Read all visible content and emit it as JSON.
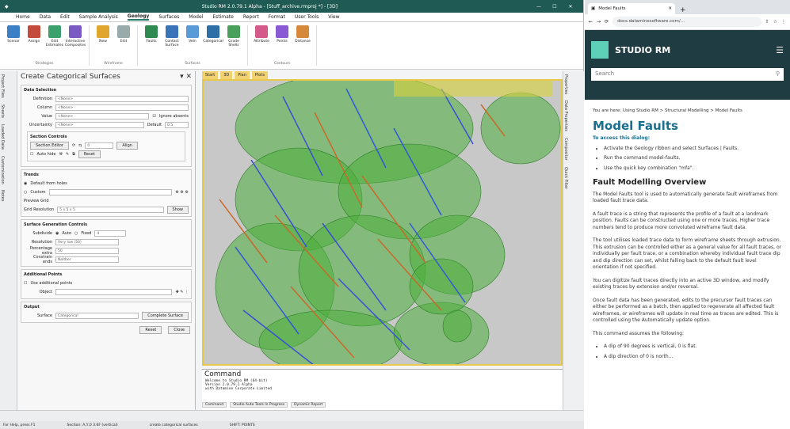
{
  "app": {
    "title": "Studio RM 2.0.79.1 Alpha - [Stuff_archive.rmproj *] - [3D]",
    "menu": [
      "Home",
      "Data",
      "Edit",
      "Sample Analysis",
      "Geology",
      "Surfaces",
      "Model",
      "Estimate",
      "Report",
      "Format",
      "User Tools",
      "View"
    ],
    "ribbon_groups": [
      {
        "label": "Strategies",
        "buttons": [
          "Scenar",
          "Assign",
          "Edit Estimates",
          "Interactive Composites"
        ]
      },
      {
        "label": "Wireframe",
        "buttons": [
          "New",
          "Edit"
        ]
      },
      {
        "label": "Surfaces",
        "buttons": [
          "Faults",
          "Contact Surface",
          "Vein",
          "Categorical",
          "Grade Shells"
        ]
      },
      {
        "label": "Contours",
        "buttons": [
          "Attribute",
          "Points",
          "Distance"
        ]
      }
    ]
  },
  "left_tabs": [
    "Project Files",
    "Sheets",
    "Loaded Data",
    "Customization",
    "Notes"
  ],
  "panel": {
    "title": "Create Categorical Surfaces",
    "data_selection": {
      "header": "Data Selection",
      "fields": [
        {
          "label": "Definition",
          "value": "<None>"
        },
        {
          "label": "Column",
          "value": "<None>"
        },
        {
          "label": "Value",
          "value": "<None>"
        },
        {
          "label": "Uncertainty",
          "value": "<None>"
        }
      ],
      "ignore_absent": "Ignore absents",
      "default_label": "Default",
      "default_value": "0.5"
    },
    "section_controls": {
      "header": "Section Controls",
      "section_editor": "Section Editor",
      "auto_hide": "Auto hide",
      "step": "0",
      "align": "Align",
      "reset": "Reset"
    },
    "trends": {
      "header": "Trends",
      "default": "Default from holes",
      "custom": "Custom",
      "preview_grid": "Preview Grid",
      "grid_resolution_label": "Grid Resolution",
      "grid_resolution": "5 x 5 x 5",
      "show": "Show"
    },
    "surface_generation": {
      "header": "Surface Generation Controls",
      "subdivide": "Subdivide",
      "auto": "Auto",
      "fixed": "Fixed",
      "fixed_value": "4",
      "resolution_label": "Resolution",
      "resolution": "Very low (50)",
      "percentage_label": "Percentage extra",
      "percentage": "50",
      "constrain_label": "Constrain ends",
      "constrain": "Neither"
    },
    "additional_points": {
      "header": "Additional Points",
      "use": "Use additional points",
      "object_label": "Object"
    },
    "output": {
      "header": "Output",
      "surface_label": "Surface",
      "surface_value": "Categorical",
      "complete": "Complete Surface"
    },
    "buttons": {
      "reset": "Reset",
      "close": "Close"
    }
  },
  "view_tabs": [
    "Start",
    "3D",
    "Plan",
    "Plots"
  ],
  "right_tabs": [
    "Properties",
    "Data Properties",
    "Compositor",
    "Quick Filter"
  ],
  "command": {
    "title": "Command",
    "lines": [
      "Welcome to Studio RM (64-bit)",
      "Version 2.0.79.1 Alpha",
      "with Datamine Corporate Limited",
      "create categorical surfaces"
    ],
    "tabs": [
      "Command",
      "Studio Auto Tools In Progress",
      "Dynamic Report"
    ]
  },
  "status": {
    "left": "For Help, press F1",
    "middle": "Section: A,Y,0 3.6F (vertical)",
    "right": "create categorical surfaces: Cancel: <none>",
    "far": "SHIFT: POINTS"
  },
  "browser": {
    "tab_title": "Model Faults",
    "url": "docs.dataminesoftware.com/...",
    "brand": "STUDIO RM",
    "search_placeholder": "Search",
    "breadcrumb": "You are here: Using Studio RM > Structural Modelling > Model Faults",
    "h1": "Model Faults",
    "access_heading": "To access this dialog:",
    "access_items": [
      "Activate the Geology ribbon and select Surfaces | Faults.",
      "Run the command model-faults.",
      "Use the quick key combination \"mfa\"."
    ],
    "h2": "Fault Modelling Overview",
    "paragraphs": [
      "The Model Faults tool is used to automatically generate fault wireframes from loaded fault trace data.",
      "A fault trace is a string that represents the profile of a fault at a landmark position. Faults can be constructed using one or more traces. Higher trace numbers tend to produce more convoluted wireframe fault data.",
      "The tool utilises loaded trace data to form wireframe sheets through extrusion. This extrusion can be controlled either as a general value for all fault traces, or individually per fault trace, or a combination whereby individual fault trace dip and dip direction can set, whilst falling back to the default fault level orientation if not specified.",
      "You can digitize fault traces directly into an active 3D window, and modify existing traces by extension and/or reversal.",
      "Once fault data has been generated, edits to the precursor fault traces can either be performed as a batch, then applied to regenerate all affected fault wireframes, or wireframes will update in real time as traces are edited. This is controlled using the Automatically update option.",
      "This command assumes the following:"
    ],
    "assume_items": [
      "A dip of 90 degrees is vertical, 0 is flat.",
      "A dip direction of 0 is north..."
    ]
  },
  "colors": {
    "app_title": "#1f5a54",
    "doc_header": "#1f3c43",
    "accent": "#1b6e8c",
    "mesh": "#4caf3c",
    "viewport_border": "#e8c84b"
  }
}
